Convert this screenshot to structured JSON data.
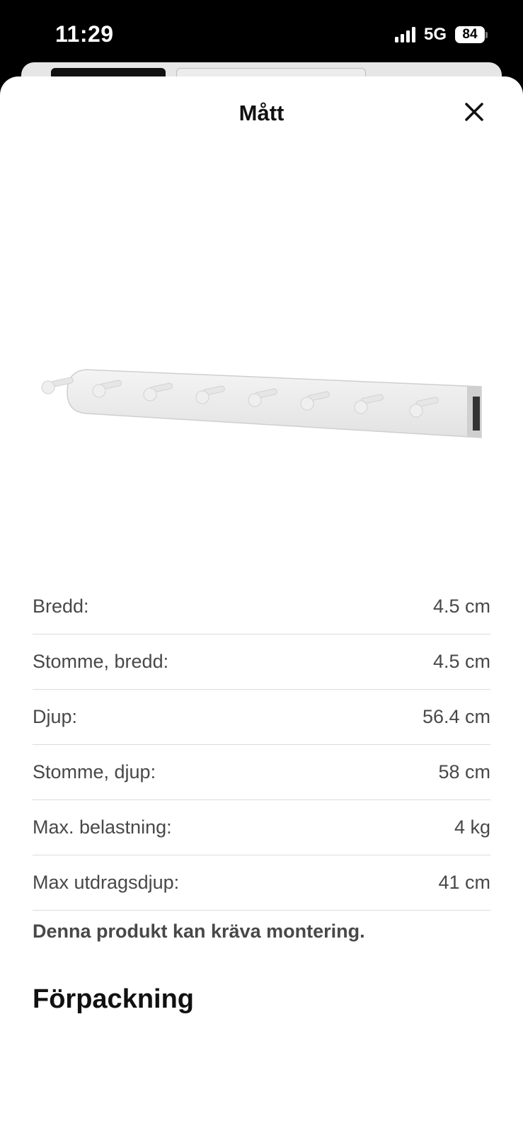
{
  "status_bar": {
    "time": "11:29",
    "network": "5G",
    "battery": "84",
    "icons": [
      "signal-icon",
      "battery-icon"
    ]
  },
  "sheet": {
    "title": "Mått",
    "close_icon": "close-icon",
    "product_image": "wall-hook-rail-with-8-pegs"
  },
  "dimensions": [
    {
      "label": "Bredd:",
      "value": "4.5 cm"
    },
    {
      "label": "Stomme, bredd:",
      "value": "4.5 cm"
    },
    {
      "label": "Djup:",
      "value": "56.4 cm"
    },
    {
      "label": "Stomme, djup:",
      "value": "58 cm"
    },
    {
      "label": "Max. belastning:",
      "value": "4 kg"
    },
    {
      "label": "Max utdragsdjup:",
      "value": "41 cm"
    }
  ],
  "notice": "Denna produkt kan kräva montering.",
  "packaging_heading": "Förpackning"
}
